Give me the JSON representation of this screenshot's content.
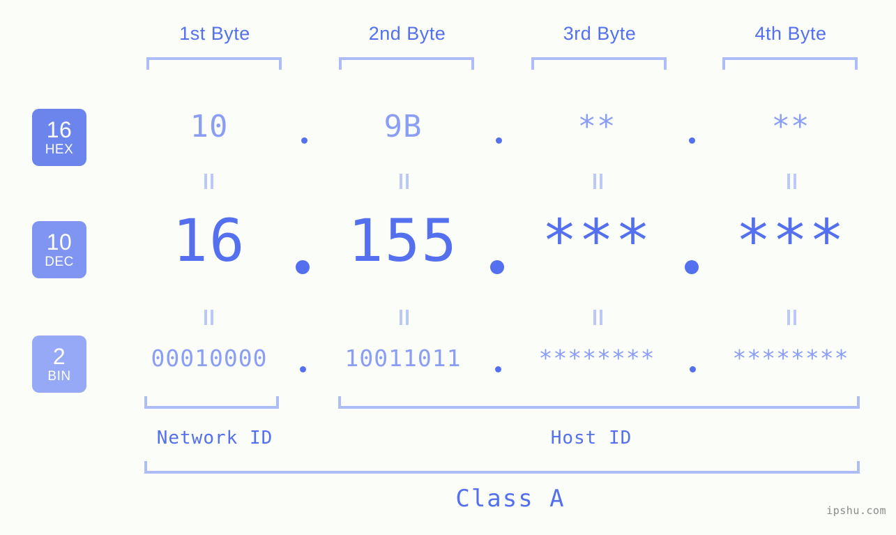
{
  "background_color": "#fbfdf8",
  "accent_color": "#5470ef",
  "accent_light_color": "#8b9ef5",
  "bracket_color": "#aebdf7",
  "byte_headers": [
    {
      "label": "1st Byte"
    },
    {
      "label": "2nd Byte"
    },
    {
      "label": "3rd Byte"
    },
    {
      "label": "4th Byte"
    }
  ],
  "bases": [
    {
      "number": "16",
      "name": "HEX",
      "color": "#6c85ec"
    },
    {
      "number": "10",
      "name": "DEC",
      "color": "#8094f2"
    },
    {
      "number": "2",
      "name": "BIN",
      "color": "#95a9f6"
    }
  ],
  "rows": {
    "hex": {
      "base": "16",
      "name": "HEX",
      "values": [
        "10",
        "9B",
        "**",
        "**"
      ]
    },
    "dec": {
      "base": "10",
      "name": "DEC",
      "values": [
        "16",
        "155",
        "***",
        "***"
      ]
    },
    "bin": {
      "base": "2",
      "name": "BIN",
      "values": [
        "00010000",
        "10011011",
        "********",
        "********"
      ]
    }
  },
  "separators": {
    "symbol": "."
  },
  "equivalence_symbol": "||",
  "segments": {
    "network_id": {
      "label": "Network ID",
      "bytes": [
        1
      ]
    },
    "host_id": {
      "label": "Host ID",
      "bytes": [
        2,
        3,
        4
      ]
    }
  },
  "class": {
    "label": "Class A"
  },
  "watermark": {
    "text": "ipshu.com"
  }
}
